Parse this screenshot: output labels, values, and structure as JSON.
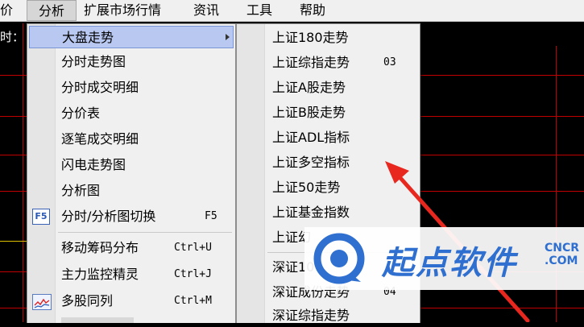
{
  "menubar": {
    "items": [
      "价",
      "分析",
      "扩展市场行情",
      "资讯",
      "工具",
      "帮助"
    ]
  },
  "chart": {
    "time_label": "时："
  },
  "analysis_menu": {
    "items": [
      {
        "label": "大盘走势"
      },
      {
        "label": "分时走势图"
      },
      {
        "label": "分时成交明细"
      },
      {
        "label": "分价表"
      },
      {
        "label": "逐笔成交明细"
      },
      {
        "label": "闪电走势图"
      },
      {
        "label": "分析图"
      },
      {
        "label": "分时/分析图切换",
        "shortcut": "F5",
        "icon_text": "F5"
      },
      {
        "label": "移动筹码分布",
        "shortcut": "Ctrl+U"
      },
      {
        "label": "主力监控精灵",
        "shortcut": "Ctrl+J"
      },
      {
        "label": "多股同列",
        "shortcut": "Ctrl+M"
      }
    ]
  },
  "market_submenu": {
    "items": [
      {
        "label": "上证180走势"
      },
      {
        "label": "上证综指走势",
        "shortcut": "03"
      },
      {
        "label": "上证A股走势"
      },
      {
        "label": "上证B股走势"
      },
      {
        "label": "上证ADL指标"
      },
      {
        "label": "上证多空指标"
      },
      {
        "label": "上证50走势"
      },
      {
        "label": "上证基金指数"
      },
      {
        "label": "上证幻"
      },
      {
        "label": "深证10"
      },
      {
        "label": "深证成份走势",
        "shortcut": "04"
      },
      {
        "label": "深证综指走势"
      }
    ]
  },
  "watermark": {
    "brand": "起点软件",
    "domain_top": "CNCR",
    "domain_bottom": ".COM"
  },
  "colors": {
    "highlight": "#b8c8f0",
    "grid": "#c00000",
    "annotation_arrow": "#e8281f",
    "watermark": "#2f6fd0"
  }
}
